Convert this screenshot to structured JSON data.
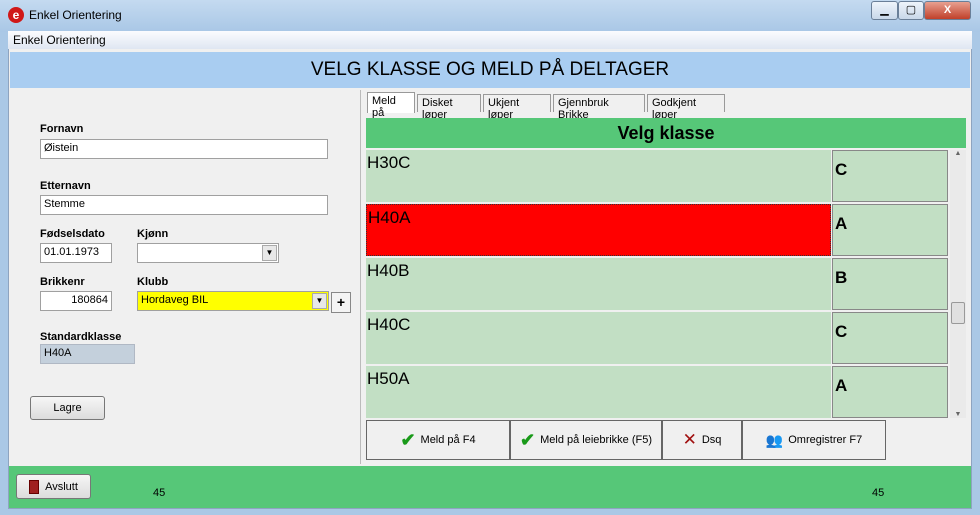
{
  "window": {
    "title": "Enkel Orientering",
    "minimize": "▁",
    "maximize": "▢",
    "close": "X"
  },
  "menu": {
    "item": "Enkel Orientering"
  },
  "header": {
    "title": "VELG KLASSE OG MELD PÅ DELTAGER"
  },
  "form": {
    "fornavn_label": "Fornavn",
    "fornavn": "Øistein",
    "etternavn_label": "Etternavn",
    "etternavn": "Stemme",
    "fodselsdato_label": "Fødselsdato",
    "fodselsdato": "01.01.1973",
    "kjonn_label": "Kjønn",
    "kjonn": "",
    "brikkenr_label": "Brikkenr",
    "brikkenr": "180864",
    "klubb_label": "Klubb",
    "klubb": "Hordaveg BIL",
    "add": "+",
    "standardklasse_label": "Standardklasse",
    "standardklasse": "H40A",
    "lagre": "Lagre"
  },
  "tabs": [
    "Meld på",
    "Disket løper",
    "Ukjent løper",
    "Gjennbruk Brikke",
    "Godkjent løper"
  ],
  "grid": {
    "title": "Velg klasse",
    "rows": [
      {
        "klasse": "H30C",
        "gruppe": "C",
        "selected": false
      },
      {
        "klasse": "H40A",
        "gruppe": "A",
        "selected": true
      },
      {
        "klasse": "H40B",
        "gruppe": "B",
        "selected": false
      },
      {
        "klasse": "H40C",
        "gruppe": "C",
        "selected": false
      },
      {
        "klasse": "H50A",
        "gruppe": "A",
        "selected": false
      }
    ]
  },
  "buttons": {
    "meld": "Meld på F4",
    "leie": "Meld på leiebrikke (F5)",
    "dsq": "Dsq",
    "omreg": "Omregistrer F7"
  },
  "footer": {
    "avslutt": "Avslutt",
    "count_left": "45",
    "count_right": "45"
  },
  "colors": {
    "selected": "#ff0000",
    "row": "#c2dfc4",
    "green": "#56c778",
    "header": "#a9cdf1",
    "klubb_bg": "#ffff00"
  }
}
